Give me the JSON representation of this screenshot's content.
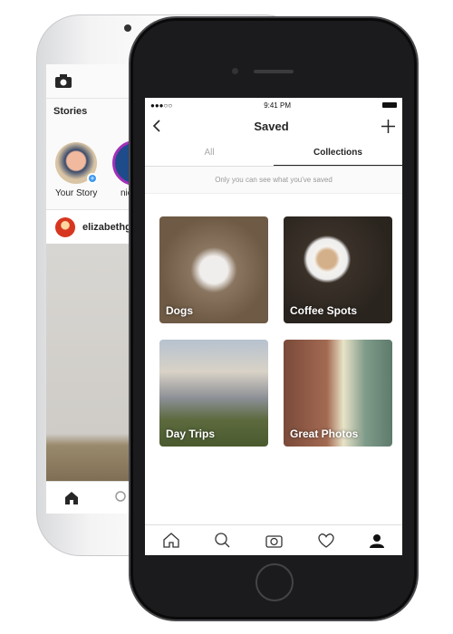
{
  "back_phone": {
    "stories_label": "Stories",
    "your_story_label": "Your Story",
    "story2_label": "nic",
    "post_username": "elizabethg"
  },
  "front_phone": {
    "status": {
      "signal": "●●●○○",
      "time": "9:41 PM"
    },
    "title": "Saved",
    "tabs": [
      {
        "label": "All",
        "active": false
      },
      {
        "label": "Collections",
        "active": true
      }
    ],
    "note": "Only you can see what you've saved",
    "collections": [
      {
        "label": "Dogs"
      },
      {
        "label": "Coffee Spots"
      },
      {
        "label": "Day Trips"
      },
      {
        "label": "Great Photos"
      }
    ],
    "nav_icons": [
      "home-icon",
      "search-icon",
      "camera-icon",
      "heart-icon",
      "profile-icon"
    ]
  }
}
